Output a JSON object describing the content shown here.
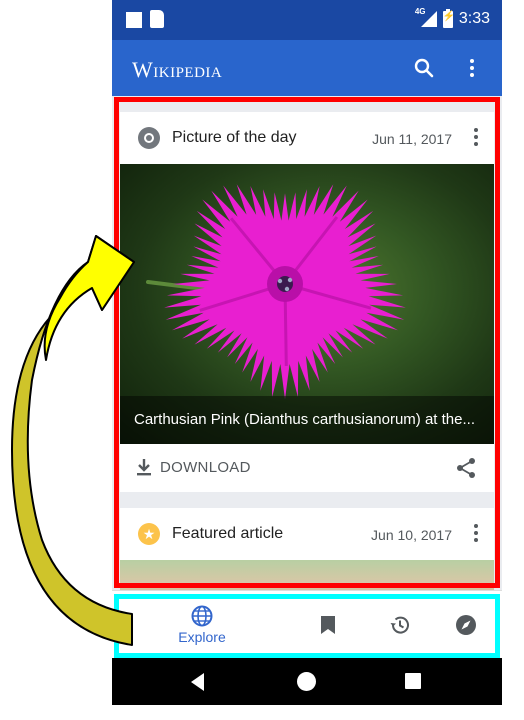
{
  "status_bar": {
    "network": "4G",
    "time": "3:33"
  },
  "app_bar": {
    "title": "Wikipedia",
    "search_icon": "search-icon",
    "more_icon": "more-vert-icon"
  },
  "cards": [
    {
      "icon": "camera-icon",
      "title": "Picture of the day",
      "date": "Jun 11, 2017",
      "image_caption": "Carthusian Pink (Dianthus carthusianorum) at the...",
      "action_label": "DOWNLOAD",
      "share_icon": "share-icon"
    },
    {
      "icon": "star-icon",
      "title": "Featured article",
      "date": "Jun 10, 2017"
    }
  ],
  "bottom_nav": {
    "items": [
      {
        "label": "Explore",
        "icon": "globe-icon",
        "active": true
      },
      {
        "label": "",
        "icon": "bookmark-icon",
        "active": false
      },
      {
        "label": "",
        "icon": "history-icon",
        "active": false
      },
      {
        "label": "",
        "icon": "compass-icon",
        "active": false
      }
    ]
  },
  "annotations": {
    "highlight_feed_color": "#ff0000",
    "highlight_nav_color": "#00ffff",
    "arrow_color": "#ffff00"
  },
  "colors": {
    "status_bar": "#1a48a3",
    "app_bar": "#2965cc",
    "accent": "#3366cc",
    "flower": "#e81fd0"
  }
}
